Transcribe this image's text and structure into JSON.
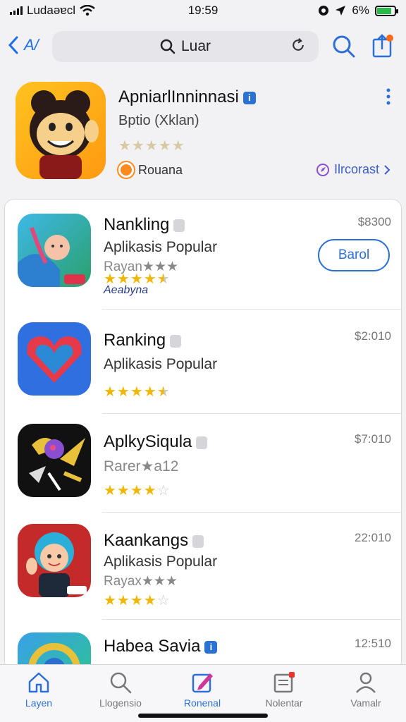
{
  "status_bar": {
    "carrier": "Ludaəɐcl",
    "time": "19:59",
    "battery": "6%"
  },
  "nav": {
    "back_label": "A/",
    "search_text": "Luar"
  },
  "featured": {
    "title": "ApniarlInninnasi",
    "subtitle": "Bptio (Xklan)",
    "rating": "★★★★★",
    "brand": "Rouana",
    "link": "Ilrcorast"
  },
  "apps": [
    {
      "name": "Nankling",
      "category": "Aplikasis Popular",
      "rank": "Rayan★★★",
      "rating": 4.5,
      "extra": "Aeabyna",
      "price": "$8300",
      "get_label": "Barol"
    },
    {
      "name": "Ranking",
      "category": "Aplikasis Popular",
      "rank": "",
      "rating": 4.5,
      "extra": "",
      "price": "$2:010",
      "get_label": ""
    },
    {
      "name": "AplkySiqula",
      "category": "",
      "rank": "Rarer★a12",
      "rating": 4,
      "extra": "",
      "price": "$7:010",
      "get_label": ""
    },
    {
      "name": "Kaankangs",
      "category": "Aplikasis Popular",
      "rank": "Rayax★★★",
      "rating": 4,
      "extra": "",
      "price": "22:010",
      "get_label": ""
    },
    {
      "name": "Habea Savia",
      "category": "",
      "rank": "",
      "rating": 0,
      "extra": "",
      "price": "12:510",
      "get_label": ""
    }
  ],
  "tabs": [
    {
      "label": "Layen",
      "icon": "home-icon"
    },
    {
      "label": "Llogensio",
      "icon": "search-icon"
    },
    {
      "label": "Ronenal",
      "icon": "edit-icon"
    },
    {
      "label": "Nolentar",
      "icon": "updates-icon"
    },
    {
      "label": "Vamalr",
      "icon": "profile-icon"
    }
  ],
  "colors": {
    "accent": "#2d6fd9",
    "star": "#f2b705",
    "battery": "#2db84b"
  }
}
